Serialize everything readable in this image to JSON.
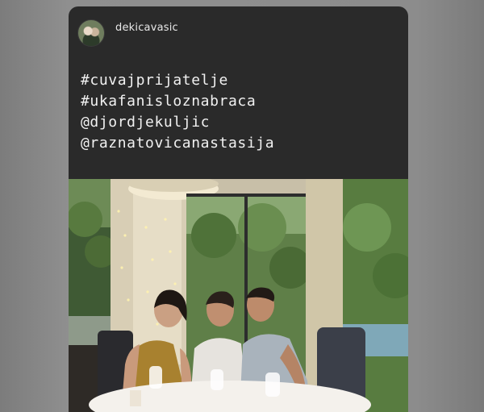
{
  "story": {
    "username": "dekicavasic",
    "avatar_icon": "profile-avatar",
    "caption_lines": [
      "#cuvajprijatelje",
      "#ukafanisloznabraca",
      "@djordjekuljic",
      "@raznatovicanastasija"
    ],
    "photo_icon": "restaurant-group-photo"
  },
  "colors": {
    "story_background": "#2a2a2a",
    "text": "#f1f1f1",
    "page_background": "#8a8a8a"
  }
}
